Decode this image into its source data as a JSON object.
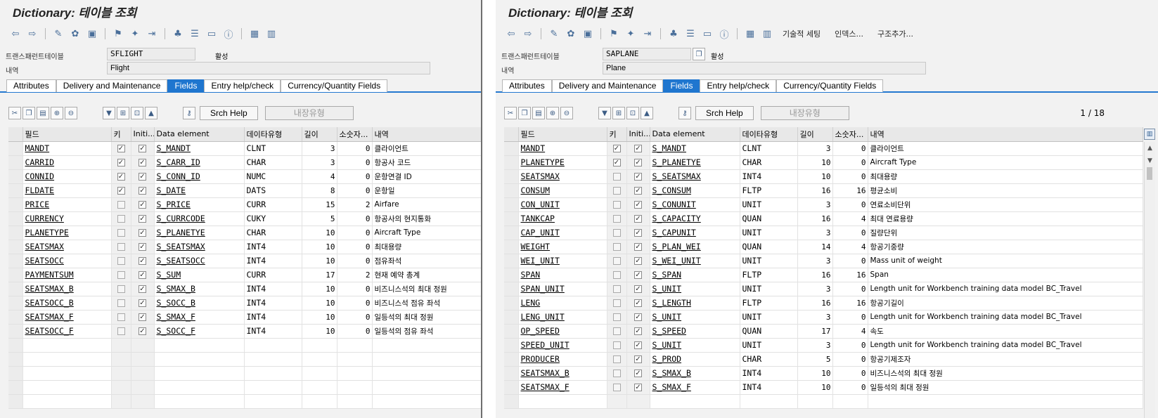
{
  "left": {
    "title": "Dictionary: 테이블 조회",
    "toolbar_texts": [],
    "table_label": "트랜스패런트테이블",
    "table_name": "SFLIGHT",
    "status": "활성",
    "desc_label": "내역",
    "description": "Flight",
    "tabs": [
      "Attributes",
      "Delivery and Maintenance",
      "Fields",
      "Entry help/check",
      "Currency/Quantity Fields"
    ],
    "active_tab": 2,
    "srch_help": "Srch Help",
    "builtin_type": "내장유형",
    "columns": [
      "필드",
      "키",
      "Initi...",
      "Data element",
      "데이타유형",
      "길이",
      "소숫자...",
      "내역"
    ],
    "rows": [
      {
        "field": "MANDT",
        "key": true,
        "init": true,
        "de": "S_MANDT",
        "type": "CLNT",
        "len": "3",
        "dec": "0",
        "desc": "클라이언트"
      },
      {
        "field": "CARRID",
        "key": true,
        "init": true,
        "de": "S_CARR_ID",
        "type": "CHAR",
        "len": "3",
        "dec": "0",
        "desc": "항공사 코드"
      },
      {
        "field": "CONNID",
        "key": true,
        "init": true,
        "de": "S_CONN_ID",
        "type": "NUMC",
        "len": "4",
        "dec": "0",
        "desc": "운항연결 ID"
      },
      {
        "field": "FLDATE",
        "key": true,
        "init": true,
        "de": "S_DATE",
        "type": "DATS",
        "len": "8",
        "dec": "0",
        "desc": "운항일"
      },
      {
        "field": "PRICE",
        "key": false,
        "init": true,
        "de": "S_PRICE",
        "type": "CURR",
        "len": "15",
        "dec": "2",
        "desc": "Airfare"
      },
      {
        "field": "CURRENCY",
        "key": false,
        "init": true,
        "de": "S_CURRCODE",
        "type": "CUKY",
        "len": "5",
        "dec": "0",
        "desc": "항공사의 현지통화"
      },
      {
        "field": "PLANETYPE",
        "key": false,
        "init": true,
        "de": "S_PLANETYE",
        "type": "CHAR",
        "len": "10",
        "dec": "0",
        "desc": "Aircraft Type"
      },
      {
        "field": "SEATSMAX",
        "key": false,
        "init": true,
        "de": "S_SEATSMAX",
        "type": "INT4",
        "len": "10",
        "dec": "0",
        "desc": "최대용량"
      },
      {
        "field": "SEATSOCC",
        "key": false,
        "init": true,
        "de": "S_SEATSOCC",
        "type": "INT4",
        "len": "10",
        "dec": "0",
        "desc": "점유좌석"
      },
      {
        "field": "PAYMENTSUM",
        "key": false,
        "init": true,
        "de": "S_SUM",
        "type": "CURR",
        "len": "17",
        "dec": "2",
        "desc": "현재 예약 총계"
      },
      {
        "field": "SEATSMAX_B",
        "key": false,
        "init": true,
        "de": "S_SMAX_B",
        "type": "INT4",
        "len": "10",
        "dec": "0",
        "desc": "비즈니스석의 최대 정원"
      },
      {
        "field": "SEATSOCC_B",
        "key": false,
        "init": true,
        "de": "S_SOCC_B",
        "type": "INT4",
        "len": "10",
        "dec": "0",
        "desc": "비즈니스석 점유 좌석"
      },
      {
        "field": "SEATSMAX_F",
        "key": false,
        "init": true,
        "de": "S_SMAX_F",
        "type": "INT4",
        "len": "10",
        "dec": "0",
        "desc": "일등석의 최대 정원"
      },
      {
        "field": "SEATSOCC_F",
        "key": false,
        "init": true,
        "de": "S_SOCC_F",
        "type": "INT4",
        "len": "10",
        "dec": "0",
        "desc": "일등석의 점유 좌석"
      }
    ]
  },
  "right": {
    "title": "Dictionary: 테이블 조회",
    "toolbar_texts": [
      "기술적 세팅",
      "인덱스...",
      "구조추가..."
    ],
    "table_label": "트랜스패런트테이블",
    "table_name": "SAPLANE",
    "status": "활성",
    "desc_label": "내역",
    "description": "Plane",
    "tabs": [
      "Attributes",
      "Delivery and Maintenance",
      "Fields",
      "Entry help/check",
      "Currency/Quantity Fields"
    ],
    "active_tab": 2,
    "srch_help": "Srch Help",
    "builtin_type": "내장유형",
    "pager": "1 / 18",
    "columns": [
      "필드",
      "키",
      "Initi...",
      "Data element",
      "데이타유형",
      "길이",
      "소숫자...",
      "내역"
    ],
    "rows": [
      {
        "field": "MANDT",
        "key": true,
        "init": true,
        "de": "S_MANDT",
        "type": "CLNT",
        "len": "3",
        "dec": "0",
        "desc": "클라이언트"
      },
      {
        "field": "PLANETYPE",
        "key": true,
        "init": true,
        "de": "S_PLANETYE",
        "type": "CHAR",
        "len": "10",
        "dec": "0",
        "desc": "Aircraft Type"
      },
      {
        "field": "SEATSMAX",
        "key": false,
        "init": true,
        "de": "S_SEATSMAX",
        "type": "INT4",
        "len": "10",
        "dec": "0",
        "desc": "최대용량"
      },
      {
        "field": "CONSUM",
        "key": false,
        "init": true,
        "de": "S_CONSUM",
        "type": "FLTP",
        "len": "16",
        "dec": "16",
        "desc": "평균소비"
      },
      {
        "field": "CON_UNIT",
        "key": false,
        "init": true,
        "de": "S_CONUNIT",
        "type": "UNIT",
        "len": "3",
        "dec": "0",
        "desc": "연료소비단위"
      },
      {
        "field": "TANKCAP",
        "key": false,
        "init": true,
        "de": "S_CAPACITY",
        "type": "QUAN",
        "len": "16",
        "dec": "4",
        "desc": "최대 연료용량"
      },
      {
        "field": "CAP_UNIT",
        "key": false,
        "init": true,
        "de": "S_CAPUNIT",
        "type": "UNIT",
        "len": "3",
        "dec": "0",
        "desc": "질량단위"
      },
      {
        "field": "WEIGHT",
        "key": false,
        "init": true,
        "de": "S_PLAN_WEI",
        "type": "QUAN",
        "len": "14",
        "dec": "4",
        "desc": "항공기중량"
      },
      {
        "field": "WEI_UNIT",
        "key": false,
        "init": true,
        "de": "S_WEI_UNIT",
        "type": "UNIT",
        "len": "3",
        "dec": "0",
        "desc": "Mass unit of weight"
      },
      {
        "field": "SPAN",
        "key": false,
        "init": true,
        "de": "S_SPAN",
        "type": "FLTP",
        "len": "16",
        "dec": "16",
        "desc": "Span"
      },
      {
        "field": "SPAN_UNIT",
        "key": false,
        "init": true,
        "de": "S_UNIT",
        "type": "UNIT",
        "len": "3",
        "dec": "0",
        "desc": "Length unit for Workbench training data model BC_Travel"
      },
      {
        "field": "LENG",
        "key": false,
        "init": true,
        "de": "S_LENGTH",
        "type": "FLTP",
        "len": "16",
        "dec": "16",
        "desc": "항공기길이"
      },
      {
        "field": "LENG_UNIT",
        "key": false,
        "init": true,
        "de": "S_UNIT",
        "type": "UNIT",
        "len": "3",
        "dec": "0",
        "desc": "Length unit for Workbench training data model BC_Travel"
      },
      {
        "field": "OP_SPEED",
        "key": false,
        "init": true,
        "de": "S_SPEED",
        "type": "QUAN",
        "len": "17",
        "dec": "4",
        "desc": "속도"
      },
      {
        "field": "SPEED_UNIT",
        "key": false,
        "init": true,
        "de": "S_UNIT",
        "type": "UNIT",
        "len": "3",
        "dec": "0",
        "desc": "Length unit for Workbench training data model BC_Travel"
      },
      {
        "field": "PRODUCER",
        "key": false,
        "init": true,
        "de": "S_PROD",
        "type": "CHAR",
        "len": "5",
        "dec": "0",
        "desc": "항공기제조자"
      },
      {
        "field": "SEATSMAX_B",
        "key": false,
        "init": true,
        "de": "S_SMAX_B",
        "type": "INT4",
        "len": "10",
        "dec": "0",
        "desc": "비즈니스석의 최대 정원"
      },
      {
        "field": "SEATSMAX_F",
        "key": false,
        "init": true,
        "de": "S_SMAX_F",
        "type": "INT4",
        "len": "10",
        "dec": "0",
        "desc": "일등석의 최대 정원"
      }
    ]
  },
  "colors": {
    "active_tab": "#1f76cf",
    "tab_rule": "#2378d0"
  }
}
